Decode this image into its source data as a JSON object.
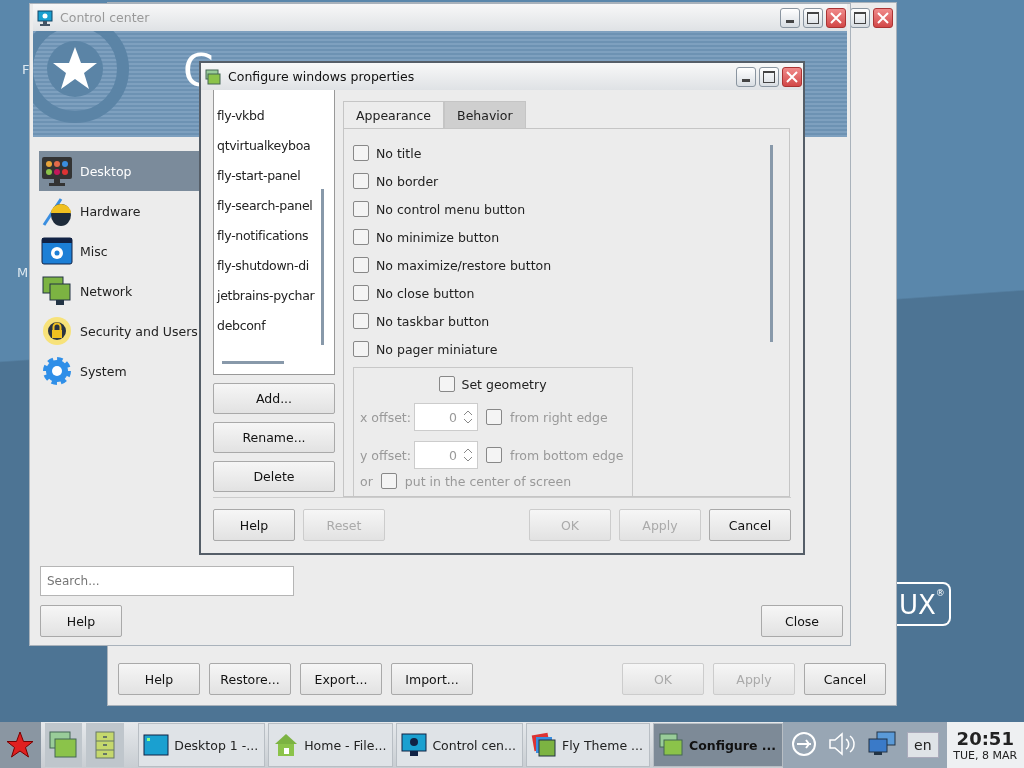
{
  "desktop": {
    "icon_labels": [
      "F",
      "M"
    ],
    "logo": "UX",
    "logo_mark": "®"
  },
  "back_window": {
    "buttons": [
      {
        "label": "Help",
        "disabled": false
      },
      {
        "label": "Restore...",
        "disabled": false
      },
      {
        "label": "Export...",
        "disabled": false
      },
      {
        "label": "Import...",
        "disabled": false
      },
      {
        "label": "OK",
        "disabled": true
      },
      {
        "label": "Apply",
        "disabled": true
      },
      {
        "label": "Cancel",
        "disabled": false
      }
    ]
  },
  "control_center": {
    "title": "Control center",
    "banner_title": "C",
    "categories": [
      {
        "label": "Desktop",
        "selected": true
      },
      {
        "label": "Hardware",
        "selected": false
      },
      {
        "label": "Misc",
        "selected": false
      },
      {
        "label": "Network",
        "selected": false
      },
      {
        "label": "Security and Users",
        "selected": false
      },
      {
        "label": "System",
        "selected": false
      }
    ],
    "search": {
      "placeholder": "Search..."
    },
    "buttons": [
      "Help",
      "Close"
    ]
  },
  "dialog": {
    "title": "Configure windows properties",
    "list": {
      "items": [
        {
          "label": "fly-vkbd",
          "selected": false
        },
        {
          "label": "qtvirtualkeyboa",
          "selected": false
        },
        {
          "label": "fly-start-panel",
          "selected": false
        },
        {
          "label": "fly-search-panel",
          "selected": false
        },
        {
          "label": "fly-notifications",
          "selected": false
        },
        {
          "label": "fly-shutdown-di",
          "selected": false
        },
        {
          "label": "jetbrains-pychar",
          "selected": false
        },
        {
          "label": "debconf",
          "selected": false
        }
      ]
    },
    "list_buttons": [
      "Add...",
      "Rename...",
      "Delete"
    ],
    "tabs": [
      {
        "label": "Appearance",
        "selected": true
      },
      {
        "label": "Behavior",
        "selected": false
      }
    ],
    "options": [
      {
        "label": "No title",
        "checked": false
      },
      {
        "label": "No border",
        "checked": false
      },
      {
        "label": "No control menu button",
        "checked": false
      },
      {
        "label": "No minimize button",
        "checked": false
      },
      {
        "label": "No maximize/restore button",
        "checked": false
      },
      {
        "label": "No close button",
        "checked": false
      },
      {
        "label": "No taskbar button",
        "checked": false
      },
      {
        "label": "No pager miniature",
        "checked": false
      }
    ],
    "geometry": {
      "label": "Set geometry",
      "checked": false,
      "x": {
        "label": "x offset:",
        "value": "0",
        "edge": {
          "label": "from right edge",
          "checked": false
        }
      },
      "y": {
        "label": "y offset:",
        "value": "0",
        "edge": {
          "label": "from bottom edge",
          "checked": false
        }
      },
      "or": "or",
      "center": {
        "label": "put in the center of screen",
        "checked": false
      }
    },
    "buttons": [
      {
        "label": "Help",
        "disabled": false
      },
      {
        "label": "Reset",
        "disabled": true
      },
      {
        "label": "OK",
        "disabled": true
      },
      {
        "label": "Apply",
        "disabled": true
      },
      {
        "label": "Cancel",
        "disabled": false
      }
    ]
  },
  "taskbar": {
    "tasks": [
      {
        "label": "Desktop 1 -...",
        "active": false
      },
      {
        "label": "Home - File...",
        "active": false
      },
      {
        "label": "Control cen...",
        "active": false
      },
      {
        "label": "Fly Theme ...",
        "active": false
      },
      {
        "label": "Configure ...",
        "active": true
      }
    ],
    "language": "en",
    "time": "20:51",
    "date": "TUE, 8 MAR"
  }
}
